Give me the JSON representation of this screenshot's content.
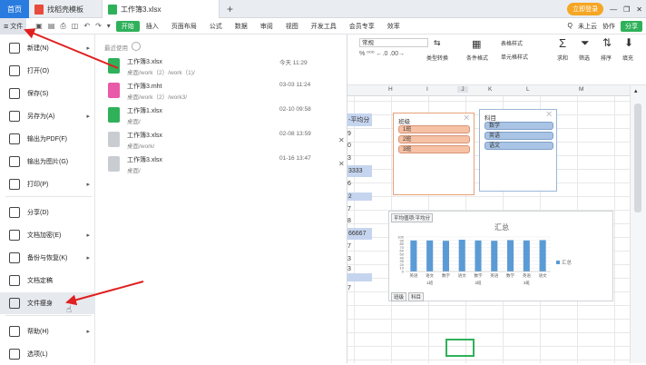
{
  "tabs": {
    "home": "首页",
    "template": "找稻壳模板",
    "file": "工作簿3.xlsx",
    "add": "+"
  },
  "window": {
    "login": "立即登录",
    "minimize": "—",
    "restore": "❐",
    "close": "✕"
  },
  "toolbar": {
    "file_menu": "文件",
    "start": "开始",
    "items": [
      "插入",
      "页面布局",
      "公式",
      "数据",
      "审阅",
      "视图",
      "开发工具",
      "会员专享",
      "效率"
    ],
    "search_placeholder": "Q",
    "cloud": "未上云",
    "collab": "协作",
    "share": "分享"
  },
  "ribbon": {
    "number_format": "常规",
    "type_convert": "类型转换",
    "cond_format": "条件格式",
    "table_style": "表格样式",
    "cell_style": "单元格样式",
    "sum": "求和",
    "filter": "筛选",
    "sort": "排序",
    "fill": "填充"
  },
  "columns": [
    "H",
    "I",
    "J",
    "K",
    "L",
    "M"
  ],
  "menu": {
    "items": [
      {
        "label": "新建(N)",
        "arrow": "▸"
      },
      {
        "label": "打开(O)",
        "arrow": ""
      },
      {
        "label": "保存(S)",
        "arrow": ""
      },
      {
        "label": "另存为(A)",
        "arrow": "▸"
      },
      {
        "label": "输出为PDF(F)",
        "arrow": ""
      },
      {
        "label": "输出为图片(G)",
        "arrow": ""
      },
      {
        "label": "打印(P)",
        "arrow": "▸"
      },
      {
        "label": "分享(D)",
        "arrow": ""
      },
      {
        "label": "文档加密(E)",
        "arrow": "▸"
      },
      {
        "label": "备份与恢复(K)",
        "arrow": "▸"
      },
      {
        "label": "文档定稿",
        "arrow": ""
      },
      {
        "label": "文件瘦身",
        "arrow": ""
      },
      {
        "label": "帮助(H)",
        "arrow": "▸"
      },
      {
        "label": "选项(L)",
        "arrow": ""
      }
    ]
  },
  "recent": {
    "heading": "最近使用",
    "files": [
      {
        "name": "工作簿3.xlsx",
        "path": "桌面/work（2）/work（1)/",
        "date": "今天 11:29",
        "color": "#2fb15a"
      },
      {
        "name": "工作簿3.mht",
        "path": "桌面/work（2）/work3/",
        "date": "03-03 11:24",
        "color": "#e95aa8"
      },
      {
        "name": "工作簿1.xlsx",
        "path": "桌面/",
        "date": "02-10 09:58",
        "color": "#2fb15a"
      },
      {
        "name": "工作簿3.xlsx",
        "path": "桌面/work/",
        "date": "02-08 13:59",
        "color": "#c9cdd2"
      },
      {
        "name": "工作簿3.xlsx",
        "path": "桌面/",
        "date": "01-16 13:47",
        "color": "#c9cdd2"
      }
    ],
    "close_glyph": "✕"
  },
  "cells": {
    "header_cell": "-平均分",
    "values": [
      "9",
      "0",
      "3",
      "3333",
      "6",
      "2",
      "7",
      "8",
      "66667",
      "7",
      "3",
      "3",
      "7"
    ]
  },
  "slicer_class": {
    "title": "班级",
    "items": [
      "1班",
      "2班",
      "3班"
    ]
  },
  "slicer_subject": {
    "title": "科目",
    "items": [
      "数学",
      "英语",
      "语文"
    ]
  },
  "chart_data": {
    "type": "bar",
    "title": "汇总",
    "field_button": "平均值项:平均分",
    "legend": "汇总",
    "categories": [
      "英语",
      "语文",
      "数学",
      "语文",
      "数学",
      "英语",
      "数学",
      "英语",
      "语文"
    ],
    "group_labels": [
      "1班",
      "2班",
      "3班"
    ],
    "values": [
      90,
      90,
      89,
      92,
      90,
      89,
      91,
      90,
      91
    ],
    "ylim": [
      0,
      100
    ],
    "yticks": [
      0,
      10,
      20,
      30,
      40,
      50,
      60,
      70,
      80,
      90,
      100
    ],
    "filter_buttons": [
      "班级",
      "科目"
    ]
  }
}
